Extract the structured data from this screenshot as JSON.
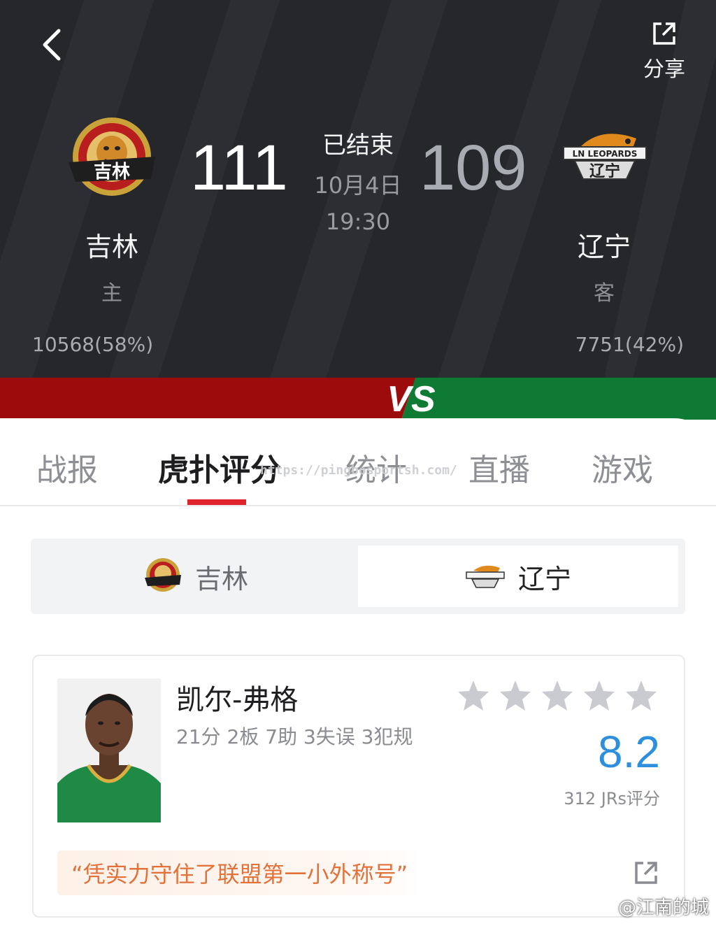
{
  "header": {
    "share_label": "分享",
    "status": "已结束",
    "date": "10月4日",
    "time": "19:30",
    "home": {
      "name": "吉林",
      "role": "主",
      "score": "111",
      "votes": "10568(58%)",
      "logo_text": "吉林"
    },
    "away": {
      "name": "辽宁",
      "role": "客",
      "score": "109",
      "votes": "7751(42%)",
      "logo_text": "辽宁",
      "logo_banner": "LN LEOPARDS"
    },
    "vs_label": "VS"
  },
  "colors": {
    "home": "#9c0c0c",
    "away": "#0f7a34",
    "accent": "#e0242e",
    "rating": "#2e8fdc",
    "comment": "#e2723a"
  },
  "tabs": [
    {
      "label": "战报"
    },
    {
      "label": "虎扑评分"
    },
    {
      "label": "统计"
    },
    {
      "label": "直播"
    },
    {
      "label": "游戏"
    }
  ],
  "active_tab": 1,
  "overlay_url": "https://pingbosportsh.com/",
  "team_switch": {
    "home_label": "吉林",
    "away_label": "辽宁",
    "selected": "away"
  },
  "player": {
    "name": "凯尔-弗格",
    "stats": "21分 2板 7助 3失误 3犯规",
    "stars": 5,
    "rating": "8.2",
    "rating_count": "312 JRs评分",
    "comment": "“凭实力守住了联盟第一小外称号”"
  },
  "watermark": "@江南的城",
  "icons": [
    "back-icon",
    "share-icon",
    "star-icon",
    "external-link-icon",
    "weibo-icon"
  ]
}
